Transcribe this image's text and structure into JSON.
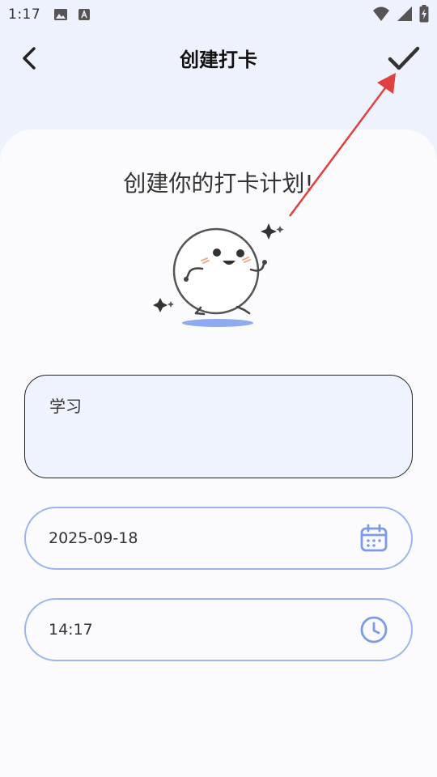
{
  "status_bar": {
    "time": "1:17"
  },
  "header": {
    "title": "创建打卡"
  },
  "main": {
    "headline": "创建你的打卡计划!",
    "content_input": {
      "value": "学习"
    },
    "date_field": {
      "value": "2025-09-18"
    },
    "time_field": {
      "value": "14:17"
    }
  },
  "colors": {
    "accent": "#7d9ae8",
    "arrow": "#e0403f",
    "background": "#eef2fc"
  }
}
